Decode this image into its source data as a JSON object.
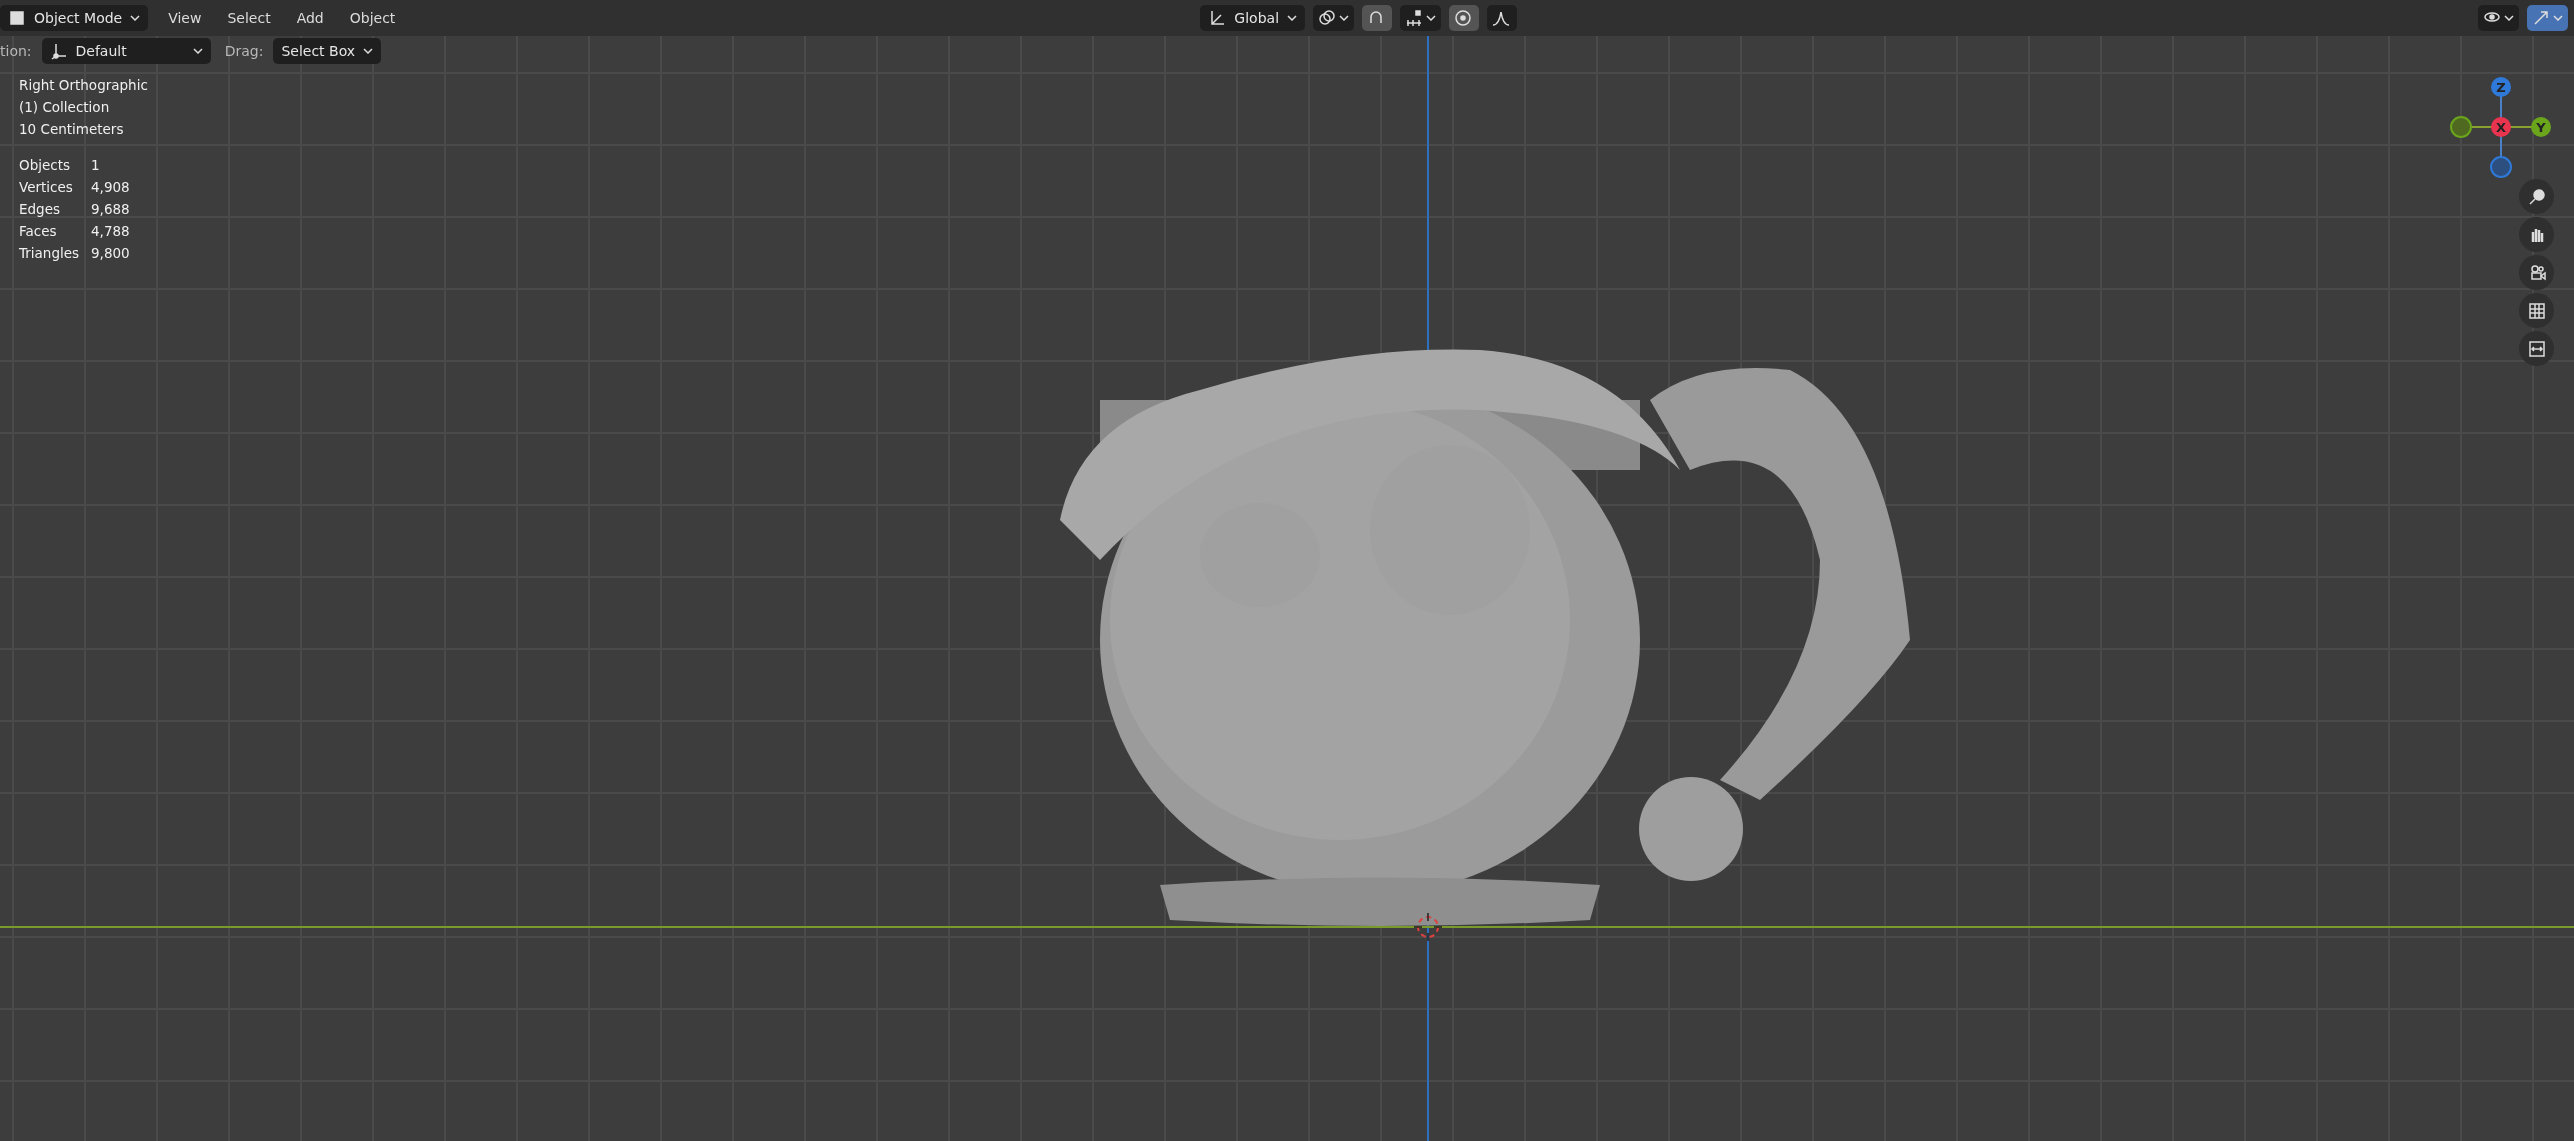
{
  "header": {
    "mode": "Object Mode",
    "menus": [
      "View",
      "Select",
      "Add",
      "Object"
    ],
    "transform_orientation": "Global",
    "snap_on": true,
    "proportional_on": true,
    "gizmos_on": true
  },
  "tool_settings": {
    "orientation_label": "tion:",
    "orientation": "Default",
    "drag_label": "Drag:",
    "drag": "Select Box"
  },
  "overlay": {
    "view": "Right Orthographic",
    "collection": "(1) Collection",
    "scale": "10 Centimeters",
    "stats": [
      {
        "label": "Objects",
        "value": "1"
      },
      {
        "label": "Vertices",
        "value": "4,908"
      },
      {
        "label": "Edges",
        "value": "9,688"
      },
      {
        "label": "Faces",
        "value": "4,788"
      },
      {
        "label": "Triangles",
        "value": "9,800"
      }
    ]
  },
  "gizmo": {
    "axes": [
      {
        "label": "Z",
        "color": "#2f79d8"
      },
      {
        "label": "X",
        "color": "#e8344f"
      },
      {
        "label": "Y",
        "color": "#6aa51c"
      }
    ]
  }
}
